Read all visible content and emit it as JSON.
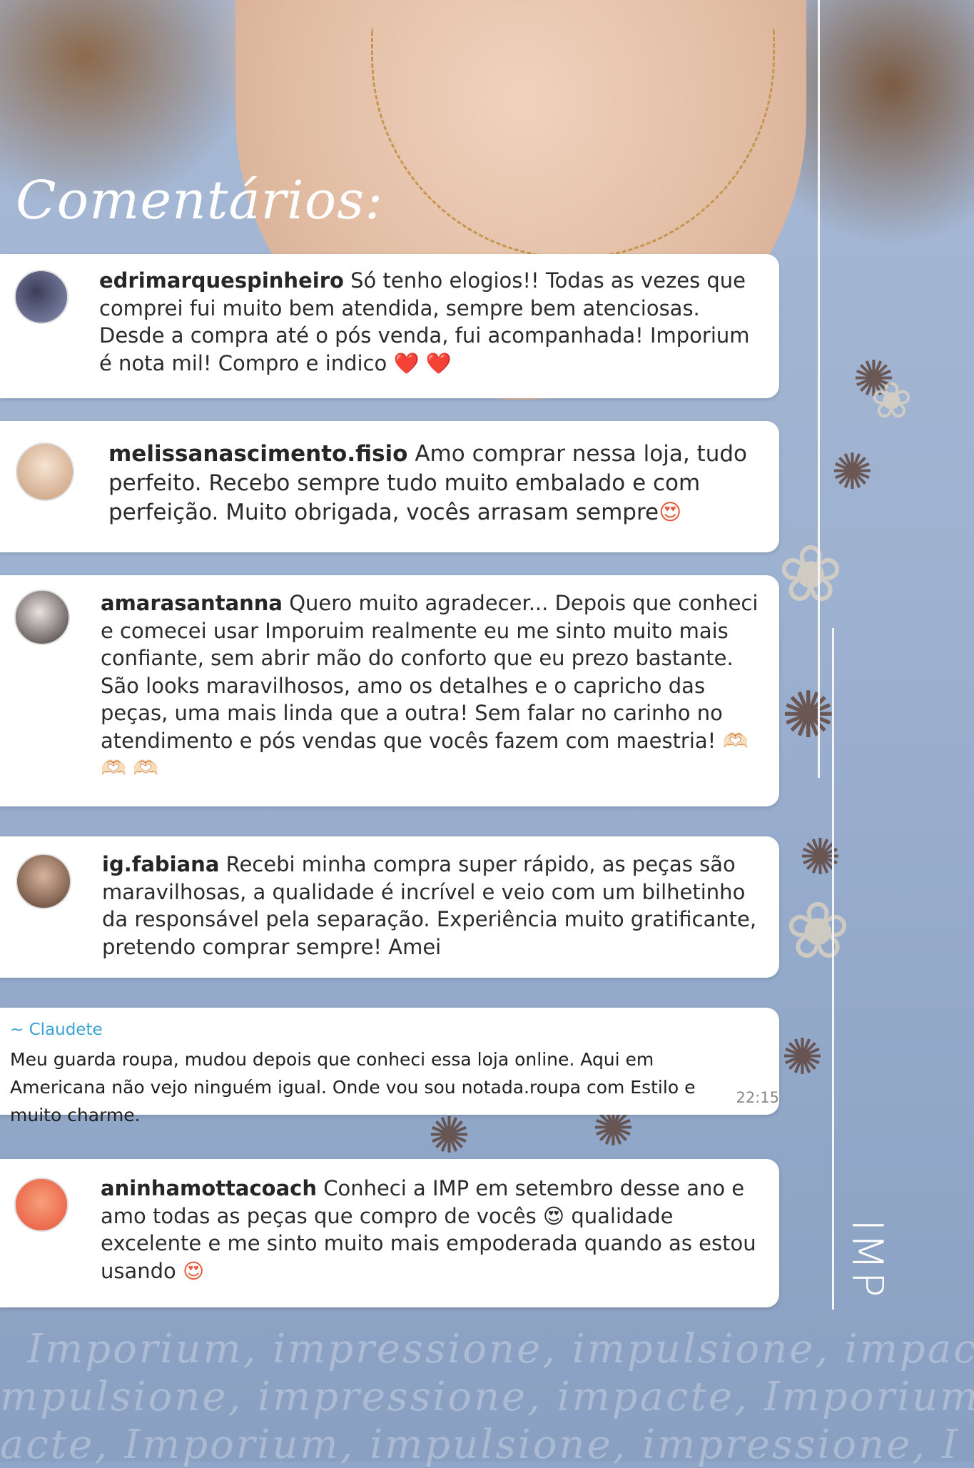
{
  "title": "Comentários:",
  "comments": [
    {
      "user": "edrimarquespinheiro",
      "text": " Só tenho elogios!! Todas as vezes que comprei fui muito bem atendida, sempre bem atenciosas. Desde a compra até o pós venda, fui acompanhada! Imporium é nota mil! Compro e indico ",
      "emoji": "❤️ ❤️"
    },
    {
      "user": "melissanascimento.fisio",
      "text": " Amo comprar nessa loja, tudo perfeito. Recebo sempre tudo muito embalado e com perfeição. Muito obrigada, vocês arrasam sempre",
      "emoji": "😍"
    },
    {
      "user": "amarasantanna",
      "text": " Quero muito agradecer... Depois que conheci e comecei usar Imporuim realmente eu me sinto muito mais confiante, sem abrir mão do conforto que eu prezo bastante. São looks maravilhosos, amo os detalhes e o capricho das peças, uma mais linda que a outra! Sem falar no carinho no atendimento e pós vendas que vocês fazem com maestria! ",
      "emoji": "🫶🏻 🫶🏻 🫶🏻"
    },
    {
      "user": "ig.fabiana",
      "text": " Recebi minha compra super rápido, as peças são maravilhosas, a qualidade é incrível e veio com um bilhetinho da responsável pela separação. Experiência muito gratificante, pretendo comprar sempre! Amei",
      "emoji": ""
    },
    {
      "user": "aninhamottacoach",
      "text": " Conheci a IMP em setembro desse ano e amo todas as peças que compro de vocês 😍 qualidade excelente e me sinto muito mais empoderada quando as estou usando ",
      "emoji": "😍"
    }
  ],
  "whatsapp": {
    "name": "~ Claudete",
    "text": "Meu guarda roupa, mudou depois que conheci essa loja online. Aqui em Americana não vejo ninguém igual. Onde vou sou notada.roupa com Estilo e muito charme.",
    "time": "22:15"
  },
  "brand": "IMP",
  "taglines": [
    "Imporium, impressione, impulsione, impac",
    "mpulsione, impressione, impacte, Imporium",
    "acte, Imporium, impulsione, impressione, I"
  ],
  "colors": {
    "background": "#9db1d0",
    "card": "#ffffff",
    "whatsapp_name": "#3aa1d5",
    "heart": "#e83e6f"
  }
}
